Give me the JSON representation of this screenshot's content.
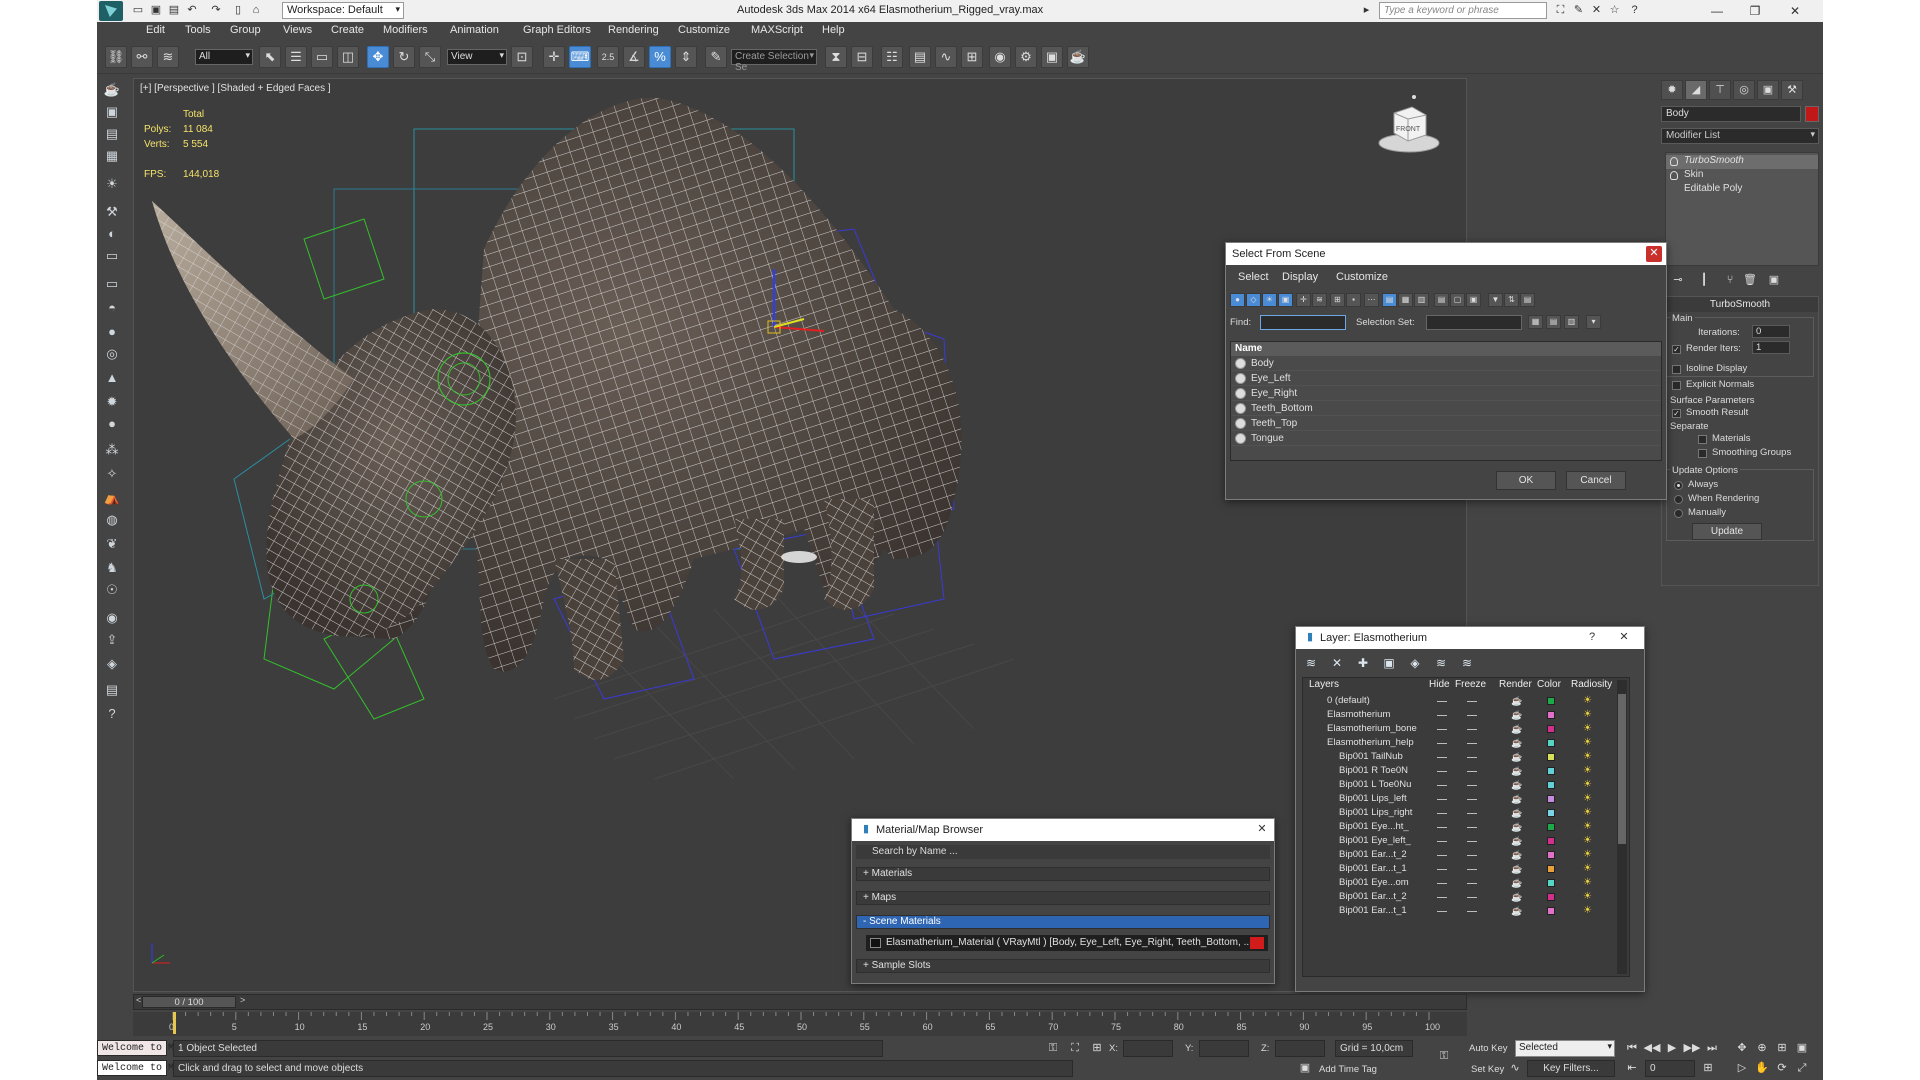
{
  "window": {
    "title": "Autodesk 3ds Max  2014 x64     Elasmotherium_Rigged_vray.max",
    "workspace": "Workspace: Default",
    "search_placeholder": "Type a keyword or phrase"
  },
  "menu": [
    "Edit",
    "Tools",
    "Group",
    "Views",
    "Create",
    "Modifiers",
    "Animation",
    "Graph Editors",
    "Rendering",
    "Customize",
    "MAXScript",
    "Help"
  ],
  "toolbar": {
    "filter_value": "All",
    "refcoord_value": "View",
    "named_selection_placeholder": "Create Selection Se",
    "snap_label": "2.5"
  },
  "viewport": {
    "label": "[+] [Perspective ] [Shaded + Edged Faces ]",
    "stats": {
      "total_label": "Total",
      "polys_label": "Polys:",
      "polys_value": "11 084",
      "verts_label": "Verts:",
      "verts_value": "5 554",
      "fps_label": "FPS:",
      "fps_value": "144,018"
    },
    "viewcube_face": "FRONT"
  },
  "command_panel": {
    "object_name": "Body",
    "object_color": "#c01818",
    "modifier_list_label": "Modifier List",
    "stack": [
      "TurboSmooth",
      "Skin",
      "Editable Poly"
    ],
    "turbosmooth": {
      "header": "TurboSmooth",
      "main_label": "Main",
      "iterations_label": "Iterations:",
      "iterations_value": "0",
      "render_iters_label": "Render Iters:",
      "render_iters_value": "1",
      "isoline_label": "Isoline Display",
      "explicit_normals_label": "Explicit Normals",
      "surface_params_label": "Surface Parameters",
      "smooth_result_label": "Smooth Result",
      "separate_label": "Separate",
      "materials_label": "Materials",
      "smoothing_groups_label": "Smoothing Groups",
      "update_options_label": "Update Options",
      "always_label": "Always",
      "when_rendering_label": "When Rendering",
      "manually_label": "Manually",
      "update_button": "Update"
    }
  },
  "select_from_scene": {
    "title": "Select From Scene",
    "menu": [
      "Select",
      "Display",
      "Customize"
    ],
    "find_label": "Find:",
    "selection_set_label": "Selection Set:",
    "column_name": "Name",
    "items": [
      "Body",
      "Eye_Left",
      "Eye_Right",
      "Teeth_Bottom",
      "Teeth_Top",
      "Tongue"
    ],
    "ok": "OK",
    "cancel": "Cancel"
  },
  "layer_dialog": {
    "title": "Layer: Elasmotherium",
    "help": "?",
    "columns": [
      "Layers",
      "Hide",
      "Freeze",
      "Render",
      "Color",
      "Radiosity"
    ],
    "rows": [
      {
        "name": "0 (default)",
        "indent": 0,
        "color": "#1fa84a"
      },
      {
        "name": "Elasmotherium",
        "indent": 0,
        "color": "#e070c8"
      },
      {
        "name": "Elasmotherium_bone",
        "indent": 0,
        "color": "#d02f8c"
      },
      {
        "name": "Elasmotherium_help",
        "indent": 0,
        "color": "#57d6c4"
      },
      {
        "name": "Bip001 TailNub",
        "indent": 1,
        "color": "#d8e05a"
      },
      {
        "name": "Bip001 R Toe0N",
        "indent": 1,
        "color": "#62d0d6"
      },
      {
        "name": "Bip001 L Toe0Nu",
        "indent": 1,
        "color": "#62d0d6"
      },
      {
        "name": "Bip001 Lips_left",
        "indent": 1,
        "color": "#c48be0"
      },
      {
        "name": "Bip001 Lips_right",
        "indent": 1,
        "color": "#7ad6e6"
      },
      {
        "name": "Bip001 Eye...ht_",
        "indent": 1,
        "color": "#1fa84a"
      },
      {
        "name": "Bip001 Eye_left_",
        "indent": 1,
        "color": "#d02f8c"
      },
      {
        "name": "Bip001 Ear...t_2",
        "indent": 1,
        "color": "#e070c8"
      },
      {
        "name": "Bip001 Ear...t_1",
        "indent": 1,
        "color": "#e8a13a"
      },
      {
        "name": "Bip001 Eye...om",
        "indent": 1,
        "color": "#57d6c4"
      },
      {
        "name": "Bip001 Ear...t_2",
        "indent": 1,
        "color": "#d02f8c"
      },
      {
        "name": "Bip001 Ear...t_1",
        "indent": 1,
        "color": "#e070c8"
      }
    ]
  },
  "material_browser": {
    "title": "Material/Map Browser",
    "search_placeholder": "Search by Name ...",
    "sections": [
      "+ Materials",
      "+ Maps",
      "- Scene Materials",
      "+ Sample Slots"
    ],
    "scene_material": "Elasmatherium_Material  ( VRayMtl )  [Body, Eye_Left, Eye_Right, Teeth_Bottom, ..."
  },
  "timeline": {
    "slider_label": "0 / 100",
    "ticks": [
      "0",
      "5",
      "10",
      "15",
      "20",
      "25",
      "30",
      "35",
      "40",
      "45",
      "50",
      "55",
      "60",
      "65",
      "70",
      "75",
      "80",
      "85",
      "90",
      "95",
      "100"
    ]
  },
  "status": {
    "maxscript": "Welcome to M",
    "selected": "1 Object Selected",
    "prompt": "Click and drag to select and move objects",
    "x_label": "X:",
    "y_label": "Y:",
    "z_label": "Z:",
    "grid": "Grid = 10,0cm",
    "add_time_tag": "Add Time Tag",
    "auto_key": "Auto Key",
    "set_key": "Set Key",
    "selected_dropdown": "Selected",
    "key_filters": "Key Filters...",
    "frame": "0"
  }
}
